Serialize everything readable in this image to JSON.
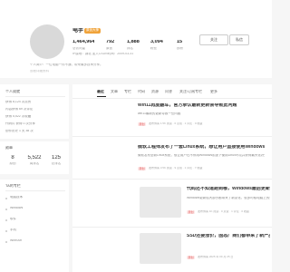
{
  "profile": {
    "name": "电手",
    "level_badge": "原创大神",
    "stats": [
      {
        "value": "1,464,964",
        "label": "总访问量"
      },
      {
        "value": "792",
        "label": "原创"
      },
      {
        "value": "1,888",
        "label": "排名"
      },
      {
        "value": "3,094",
        "label": "粉丝"
      },
      {
        "value": "15",
        "label": "铁粉"
      }
    ],
    "meta": "IP属地：湖北    加入CSDN时间：2009-03-31",
    "bio": "个人简介：一位电脑一窍不通，带来最多技术分享。",
    "bio_more": "查看详细资料",
    "follow_label": "关注",
    "message_label": "私信"
  },
  "sidebar": {
    "achievement_title": "个人成就",
    "achievements": [
      "获得 8,124 次点赞",
      "内容获得 69 次评论",
      "获得 5,522 次收藏",
      "代码片 获得 0 次分享",
      "创作历史 1 天 38 次"
    ],
    "honor_title": "勋章",
    "counters": [
      {
        "value": "8",
        "label": "原创"
      },
      {
        "value": "5,522",
        "label": "周排名"
      },
      {
        "value": "125",
        "label": "总排名"
      }
    ],
    "tags_title": "TA的专栏",
    "tags": [
      "电脑技术",
      "Windows",
      "软件",
      "手机",
      "WinRAR"
    ]
  },
  "tabs": {
    "items": [
      "最近",
      "文章",
      "专栏",
      "代码",
      "资源",
      "问答",
      "关注/订阅专栏",
      "更多"
    ]
  },
  "articles": [
    {
      "title": "Win11再度翻车，官方承认最新更新会导致此问题",
      "desc": "win11最新的更新导致一些问题",
      "meta": "发布博客 1.5K 阅读 · 0 点赞 · 1 评论 · 0 收藏"
    },
    {
      "title": "微软工程师发布了一套Linux系统，想让用户直接使用Windows",
      "desc": "微软发布全新Linux系统，想让用户在不停用Windows前提下使用Linux环境并获得最大化好处，可能是其中一种方式……",
      "meta": "发布博客 3.5K 阅读 · 9 点赞 · 1 评论 · 7 收藏"
    },
    {
      "title": "代码还不知道跑到哪，Windows最后更新给所有人都整明白了",
      "desc": "Windows更新给大部分都带来了新变化，很多时候电脑上的更新都是会被忽略，现在Windows最新更新的这个功能让我们...",
      "meta": "发布博客 1K 阅读 · 0 点赞 · 1 评论 · 0 收藏"
    },
    {
      "title": "SSD还要涨价，固态厂商们都带来了新产品？",
      "desc": "",
      "meta": "发布博客 2025 年 09 月 25 日"
    }
  ],
  "badge_label": "原创"
}
